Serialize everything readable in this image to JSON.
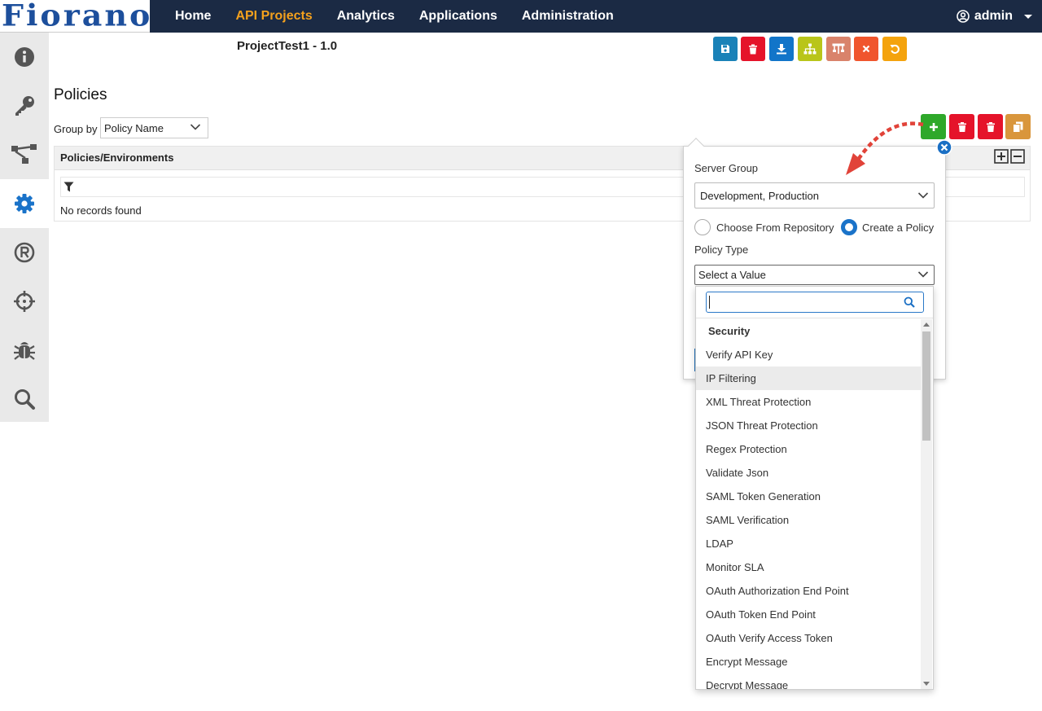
{
  "brand": {
    "logo_text": "Fiorano"
  },
  "nav": {
    "items": [
      "Home",
      "API Projects",
      "Analytics",
      "Applications",
      "Administration"
    ],
    "active": "API Projects"
  },
  "user": {
    "name": "admin"
  },
  "sidebar": {
    "items": [
      "info-icon",
      "key-icon",
      "flow-icon",
      "settings-icon",
      "registered-icon",
      "crosshair-icon",
      "bug-icon",
      "search-icon"
    ],
    "active": "settings-icon"
  },
  "project": {
    "title": "ProjectTest1 - 1.0"
  },
  "toolbar": {
    "colors": {
      "save": "#1a82b8",
      "delete": "#e5132a",
      "download": "#1275c9",
      "hierarchy": "#b9c51a",
      "flow": "#d9836b",
      "close": "#f0552d",
      "undo": "#f4a30d"
    }
  },
  "policies": {
    "title": "Policies",
    "group_by_label": "Group by",
    "group_by_value": "Policy Name",
    "grid_header": "Policies/Environments",
    "empty_text": "No records found"
  },
  "actions": {
    "colors": {
      "add": "#2ea82a",
      "delete1": "#e5132a",
      "delete2": "#e5132a",
      "copy": "#d9963c"
    }
  },
  "popover": {
    "server_group_label": "Server Group",
    "server_group_value": "Development, Production",
    "radio_repo_label": "Choose From Repository",
    "radio_create_label": "Create a Policy",
    "selected_radio": "Create a Policy",
    "policy_type_label": "Policy Type",
    "policy_type_placeholder": "Select a Value"
  },
  "dropdown": {
    "search_value": "",
    "group": "Security",
    "items": [
      "Verify API Key",
      "IP Filtering",
      "XML Threat Protection",
      "JSON Threat Protection",
      "Regex Protection",
      "Validate Json",
      "SAML Token Generation",
      "SAML Verification",
      "LDAP",
      "Monitor SLA",
      "OAuth Authorization End Point",
      "OAuth Token End Point",
      "OAuth Verify Access Token",
      "Encrypt Message",
      "Decrypt Message"
    ],
    "highlighted": "IP Filtering"
  }
}
